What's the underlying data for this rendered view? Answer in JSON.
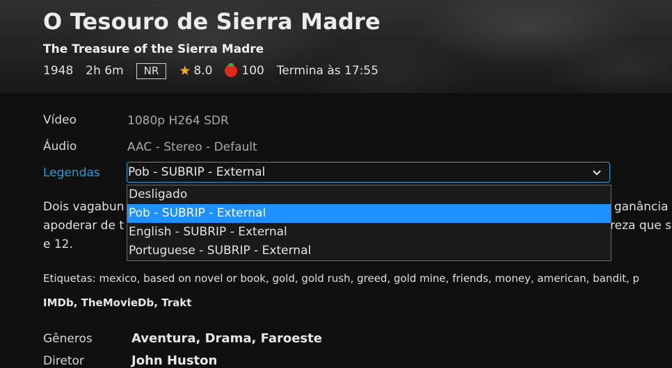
{
  "hero": {
    "title": "O Tesouro de Sierra Madre",
    "original_title": "The Treasure of the Sierra Madre",
    "year": "1948",
    "runtime": "2h 6m",
    "official_rating": "NR",
    "community_rating": "8.0",
    "critic_rating": "100",
    "ends_at": "Termina às 17:55",
    "icons": {
      "star": "star-icon",
      "tomato": "tomato-icon"
    },
    "colors": {
      "star": "#f2b01e",
      "tomato": "#e1291d"
    }
  },
  "media_info": {
    "video_label": "Vídeo",
    "video_value": "1080p H264 SDR",
    "audio_label": "Áudio",
    "audio_value": "AAC - Stereo - Default",
    "subtitles_label": "Legendas",
    "subtitles_selected": "Pob - SUBRIP - External",
    "accent_color": "#2a9bd6"
  },
  "subtitle_options": [
    "Desligado",
    "Pob - SUBRIP - External",
    "English - SUBRIP - External",
    "Portuguese - SUBRIP - External"
  ],
  "selected_option_color": "#1e90ff",
  "overview": {
    "line1_start": "Dois vagabun",
    "line1_end": "a ganância",
    "line2_start": "apoderar de t",
    "line2_end": "reza que se",
    "line3": "e 12."
  },
  "tags": {
    "text": "Etiquetas: mexico, based on novel or book, gold, gold rush, greed, gold mine, friends, money, american, bandit, p"
  },
  "external_links": {
    "imdb": "IMDb",
    "tmdb": "TheMovieDb",
    "trakt": "Trakt",
    "separator": ", "
  },
  "genres": {
    "label": "Gêneros",
    "items": [
      "Aventura",
      "Drama",
      "Faroeste"
    ],
    "separator": ", "
  },
  "director": {
    "label": "Diretor",
    "value": "John Huston"
  }
}
